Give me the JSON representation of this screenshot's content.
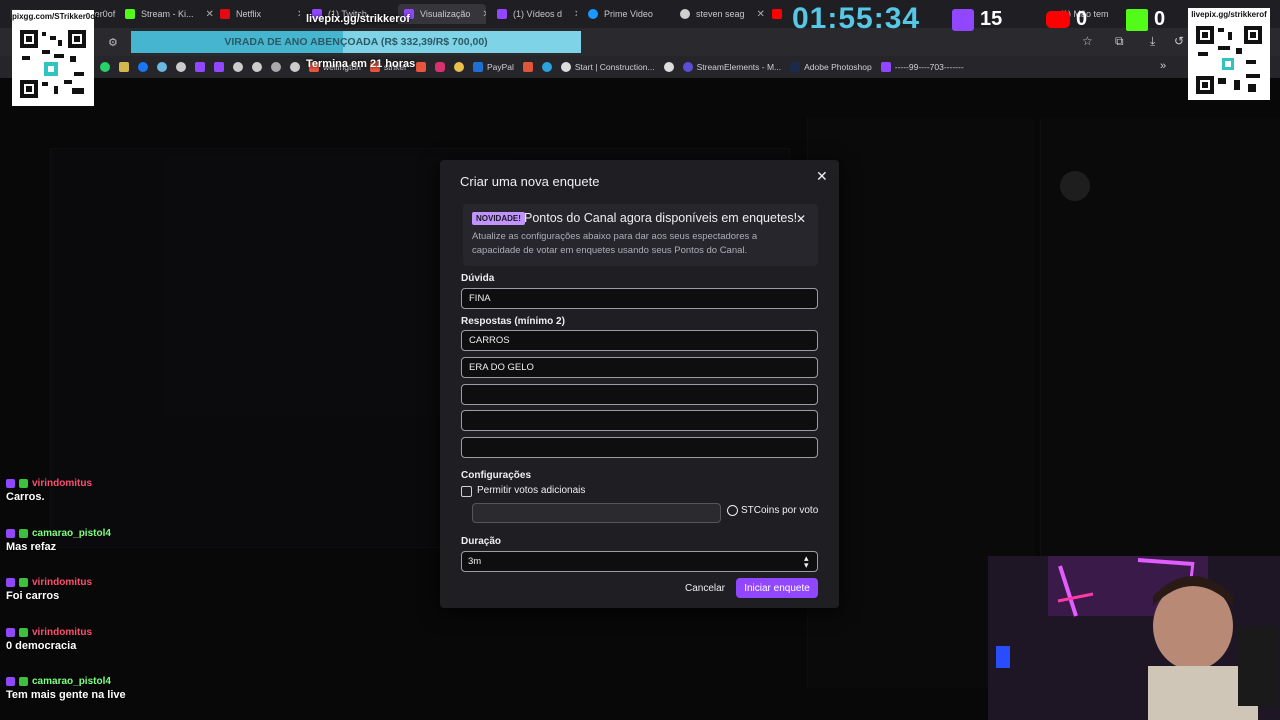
{
  "tabs": [
    {
      "label": "pixgg.com/STrikker0of",
      "color": "#2b2b30"
    },
    {
      "label": "Stream - Ki...",
      "color": "#53fc18"
    },
    {
      "label": "Netflix",
      "color": "#e50914"
    },
    {
      "label": "(1) Twitch",
      "color": "#9147ff"
    },
    {
      "label": "Visualização",
      "color": "#9147ff"
    },
    {
      "label": "(1) Vídeos d",
      "color": "#9147ff"
    },
    {
      "label": "Prime Video",
      "color": "#1a98ff"
    },
    {
      "label": "steven seag",
      "color": "#cfcfcf"
    },
    {
      "label": "(1)",
      "color": "#ff0000"
    },
    {
      "label": "horas",
      "color": "#9147ff"
    },
    {
      "label": "Tu Sa",
      "color": "#9147ff"
    },
    {
      "label": "(1) Mão tem",
      "color": "#ff0000"
    }
  ],
  "overlay": {
    "livepix_top": "livepix.gg/strikkerof",
    "banner_text": "VIRADA DE ANO ABENÇOADA (R$ 332,39/R$ 700,00)",
    "banner_progress": 0.47,
    "termina": "Termina em 21 horas",
    "timer": "01:55:34",
    "stat_twitch": "15",
    "stat_youtube": "0",
    "stat_kick": "0",
    "qr_left_label": "pixgg.com/STrikker0of",
    "qr_right_label": "livepix.gg/strikkerof"
  },
  "bookmarks": [
    "",
    "",
    "",
    "",
    "",
    "",
    "",
    "",
    "",
    "",
    "",
    "wellington",
    "striker",
    "",
    "",
    "",
    "PayPal",
    "",
    "",
    "Start | Construction...",
    "",
    "StreamElements - M...",
    "Adobe Photoshop",
    "-----99----703-------"
  ],
  "modal": {
    "title": "Criar uma nova enquete",
    "notice_badge": "NOVIDADE!",
    "notice_title": "Pontos do Canal agora disponíveis em enquetes!",
    "notice_body": "Atualize as configurações abaixo para dar aos seus espectadores a capacidade de votar em enquetes usando seus Pontos do Canal.",
    "question_label": "Dúvida",
    "question_value": "FINA",
    "answers_label": "Respostas (mínimo 2)",
    "answers": [
      "CARROS",
      "ERA DO GELO",
      "",
      "",
      ""
    ],
    "config_label": "Configurações",
    "checkbox_label": "Permitir votos adicionais",
    "coins_label": "STCoins por voto",
    "duration_label": "Duração",
    "duration_value": "3m",
    "cancel_label": "Cancelar",
    "start_label": "Iniciar enquete"
  },
  "chat": [
    {
      "user": "virindomitus",
      "text": "Carros.",
      "color": "#ff4d6d"
    },
    {
      "user": "camarao_pistol4",
      "text": "Mas refaz",
      "color": "#7fff7f"
    },
    {
      "user": "virindomitus",
      "text": "Foi carros",
      "color": "#ff4d6d"
    },
    {
      "user": "virindomitus",
      "text": "0 democracia",
      "color": "#ff4d6d"
    },
    {
      "user": "camarao_pistol4",
      "text": "Tem mais gente na live",
      "color": "#7fff7f"
    }
  ]
}
